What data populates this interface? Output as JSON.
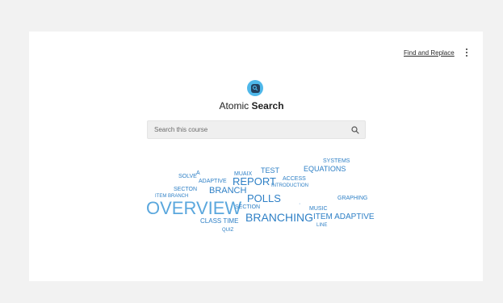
{
  "header": {
    "find_replace_label": "Find and Replace",
    "more_icon": "vertical-ellipsis-icon"
  },
  "brand": {
    "logo_icon": "search-logo-icon",
    "title_prefix": "Atomic",
    "title_bold": "Search"
  },
  "search": {
    "placeholder": "Search this course",
    "value": "",
    "icon": "magnifier-icon"
  },
  "word_cloud": [
    "SYSTEMS",
    "EQUATIONS",
    "TEST",
    "SOLVE",
    "A",
    "MUAIX",
    "ACCESS",
    "ADAPTIVE",
    "REPORT",
    "INTRODUCTION",
    "SECTON",
    "BRANCH",
    "ITEM BRANCH",
    "POLLS",
    "GRAPHING",
    "OVERVIEW",
    "SECTION",
    "·",
    "MUSIC",
    "BRANCHING",
    "ITEM ADAPTIVE",
    "CLASS TIME",
    "LINE",
    "QUIZ"
  ],
  "colors": {
    "background": "#f2f2f2",
    "card": "#ffffff",
    "accent": "#4fb8ea",
    "logo_dark": "#23405e",
    "word": "#2f80c6"
  }
}
